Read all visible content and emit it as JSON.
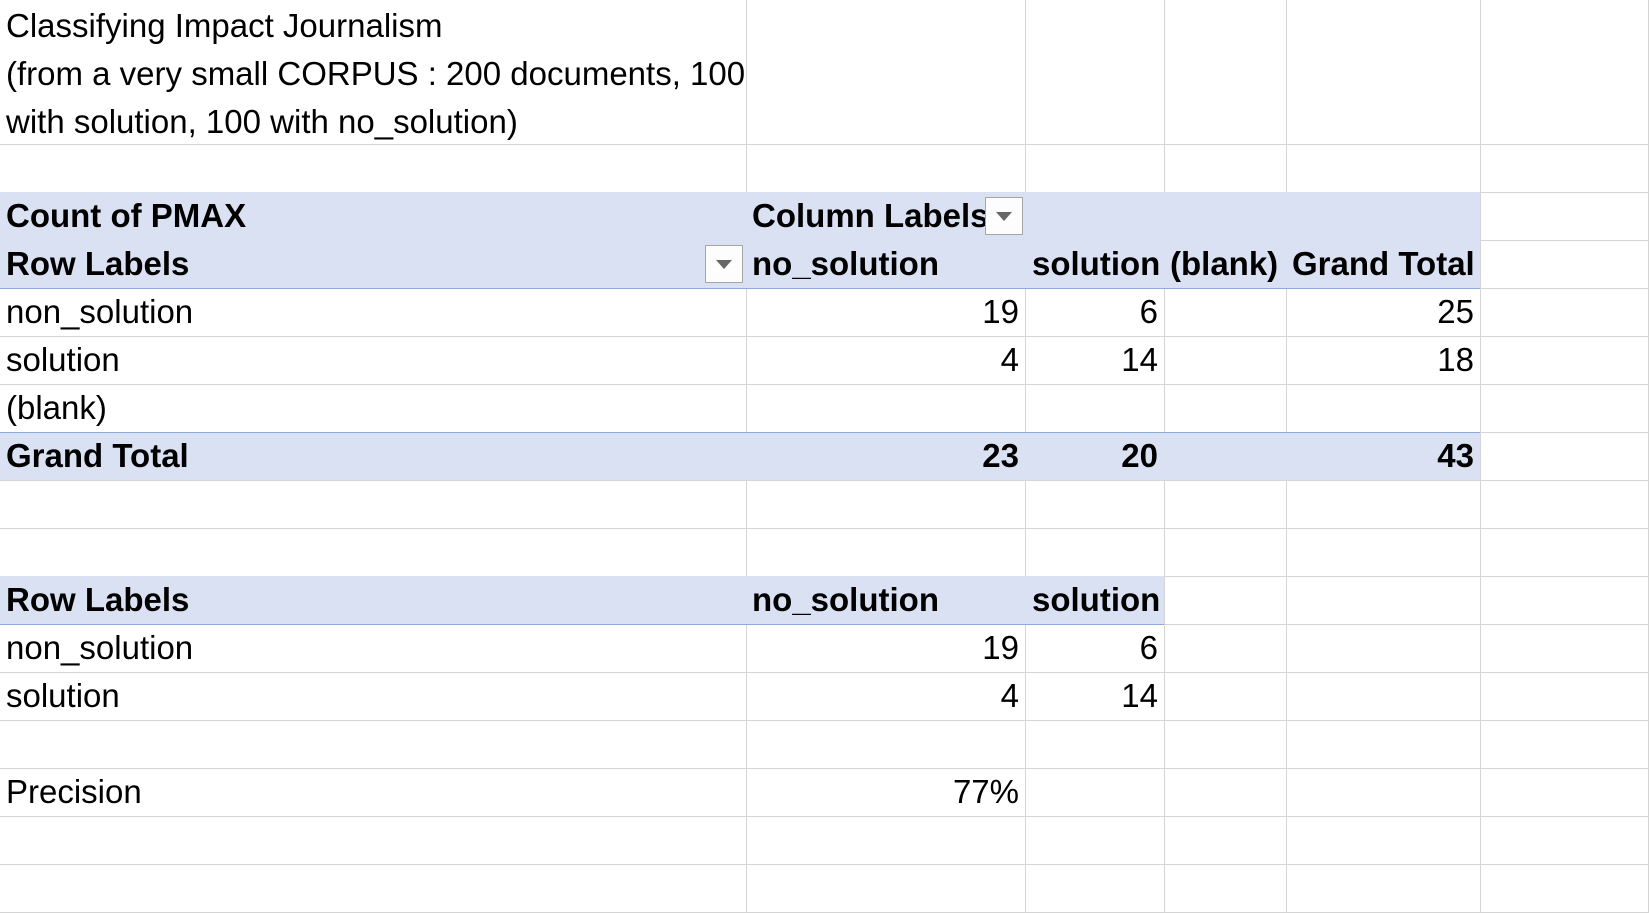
{
  "title": {
    "line1": "Classifying Impact Journalism",
    "line2": "(from a very small CORPUS : 200 documents, 100",
    "line3": "with solution, 100 with no_solution)"
  },
  "pivot": {
    "measure": "Count of PMAX",
    "column_labels": "Column Labels",
    "row_labels": "Row Labels",
    "col_headers": [
      "no_solution",
      "solution",
      "(blank)",
      "Grand Total"
    ],
    "rows": [
      {
        "label": "non_solution",
        "values": [
          "19",
          "6",
          "",
          "25"
        ]
      },
      {
        "label": "solution",
        "values": [
          "4",
          "14",
          "",
          "18"
        ]
      },
      {
        "label": "(blank)",
        "values": [
          "",
          "",
          "",
          ""
        ]
      }
    ],
    "grand_total": {
      "label": "Grand Total",
      "values": [
        "23",
        "20",
        "",
        "43"
      ]
    }
  },
  "confusion": {
    "row_labels": "Row Labels",
    "col_headers": [
      "no_solution",
      "solution"
    ],
    "rows": [
      {
        "label": "non_solution",
        "values": [
          "19",
          "6"
        ]
      },
      {
        "label": "solution",
        "values": [
          "4",
          "14"
        ]
      }
    ]
  },
  "precision": {
    "label": "Precision",
    "value": "77%"
  },
  "colors": {
    "header_band": "#dae1f3",
    "band_border": "#8ea9db",
    "gridline": "#d4d4d4"
  }
}
